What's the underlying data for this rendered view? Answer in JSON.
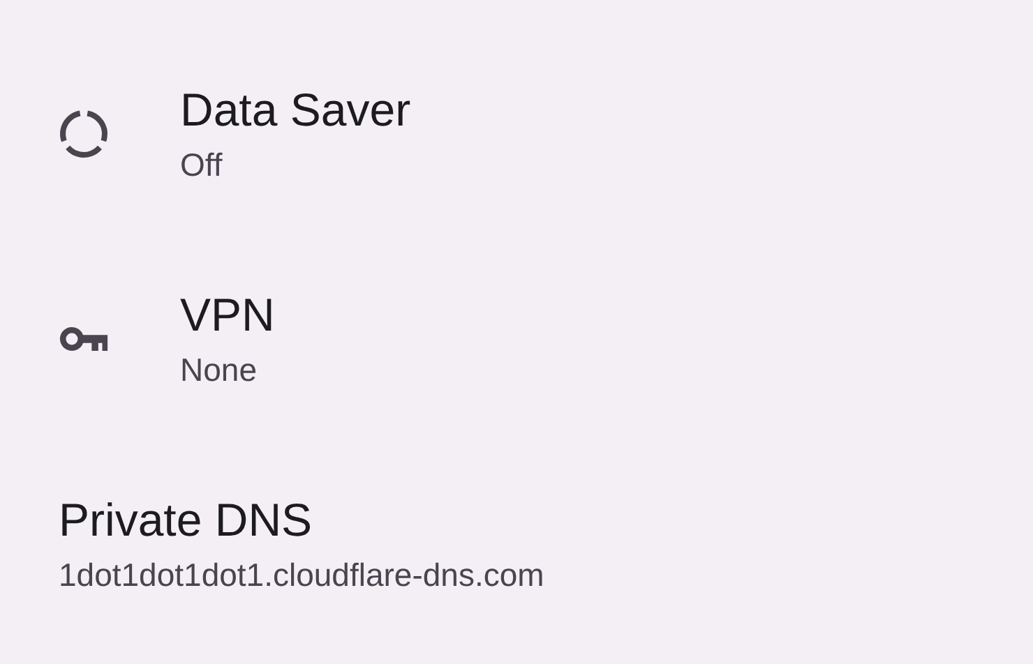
{
  "settings": [
    {
      "kind": "with-icon",
      "title": "Data Saver",
      "summary": "Off"
    },
    {
      "kind": "with-icon",
      "title": "VPN",
      "summary": "None"
    },
    {
      "kind": "plain",
      "title": "Private DNS",
      "summary": "1dot1dot1dot1.cloudflare-dns.com"
    }
  ]
}
